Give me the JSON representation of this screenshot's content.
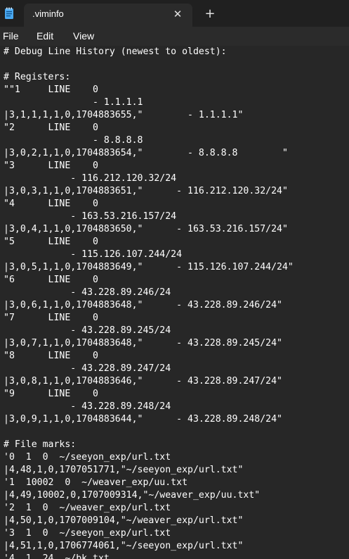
{
  "window": {
    "tab_title": ".viminfo",
    "tab_close_glyph": "✕",
    "new_tab_glyph": "+",
    "icon": "notepad-icon"
  },
  "menu": {
    "file": "File",
    "edit": "Edit",
    "view": "View"
  },
  "colors": {
    "background": "#272727",
    "titlebar": "#202020",
    "menubar": "#2b2b2b",
    "text": "#ffffff",
    "icon_accent": "#4aa8f0"
  },
  "editor": {
    "lines": [
      "# Debug Line History (newest to oldest):",
      "",
      "# Registers:",
      "\"\"1     LINE    0",
      "                - 1.1.1.1",
      "|3,1,1,1,1,0,1704883655,\"        - 1.1.1.1\"",
      "\"2      LINE    0",
      "                - 8.8.8.8",
      "|3,0,2,1,1,0,1704883654,\"        - 8.8.8.8        \"",
      "\"3      LINE    0",
      "            - 116.212.120.32/24",
      "|3,0,3,1,1,0,1704883651,\"      - 116.212.120.32/24\"",
      "\"4      LINE    0",
      "            - 163.53.216.157/24",
      "|3,0,4,1,1,0,1704883650,\"      - 163.53.216.157/24\"",
      "\"5      LINE    0",
      "            - 115.126.107.244/24",
      "|3,0,5,1,1,0,1704883649,\"      - 115.126.107.244/24\"",
      "\"6      LINE    0",
      "            - 43.228.89.246/24",
      "|3,0,6,1,1,0,1704883648,\"      - 43.228.89.246/24\"",
      "\"7      LINE    0",
      "            - 43.228.89.245/24",
      "|3,0,7,1,1,0,1704883648,\"      - 43.228.89.245/24\"",
      "\"8      LINE    0",
      "            - 43.228.89.247/24",
      "|3,0,8,1,1,0,1704883646,\"      - 43.228.89.247/24\"",
      "\"9      LINE    0",
      "            - 43.228.89.248/24",
      "|3,0,9,1,1,0,1704883644,\"      - 43.228.89.248/24\"",
      "",
      "# File marks:",
      "'0  1  0  ~/seeyon_exp/url.txt",
      "|4,48,1,0,1707051771,\"~/seeyon_exp/url.txt\"",
      "'1  10002  0  ~/weaver_exp/uu.txt",
      "|4,49,10002,0,1707009314,\"~/weaver_exp/uu.txt\"",
      "'2  1  0  ~/weaver_exp/url.txt",
      "|4,50,1,0,1707009104,\"~/weaver_exp/url.txt\"",
      "'3  1  0  ~/seeyon_exp/url.txt",
      "|4,51,1,0,1706774061,\"~/seeyon_exp/url.txt\"",
      "'4  1  24  ~/bk.txt"
    ]
  }
}
